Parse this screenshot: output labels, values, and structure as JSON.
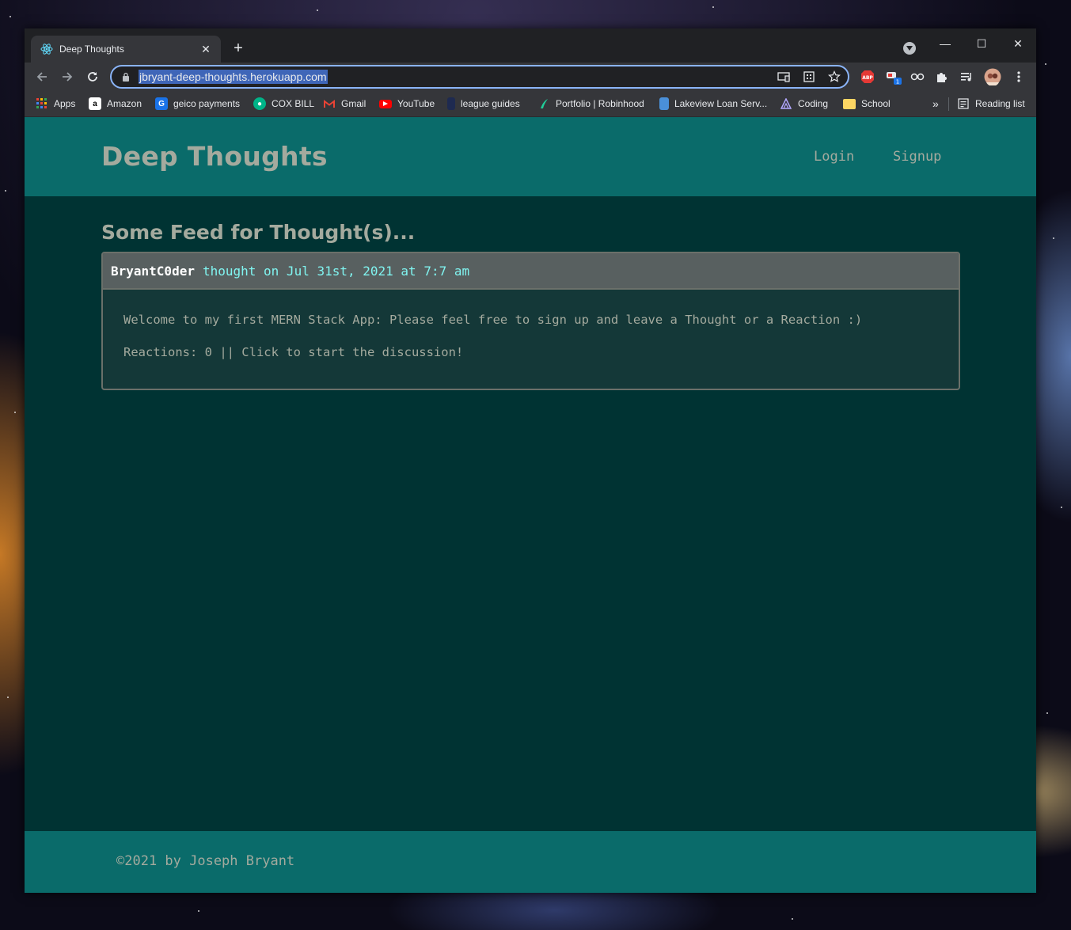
{
  "browser": {
    "tab_title": "Deep Thoughts",
    "url": "jbryant-deep-thoughts.herokuapp.com",
    "icons": {
      "tab_favicon": "react-atom-icon",
      "new_tab": "plus-icon",
      "close": "close-icon",
      "back": "back-arrow-icon",
      "forward": "forward-arrow-icon",
      "reload": "reload-icon",
      "lock": "lock-icon",
      "cast": "cast-icon",
      "qr": "qr-code-icon",
      "star": "bookmark-star-icon",
      "extensions": "puzzle-icon",
      "media": "media-control-icon",
      "menu": "kebab-menu-icon"
    },
    "extensions": [
      "ABP",
      "1"
    ],
    "bookmarks": [
      {
        "label": "Apps",
        "icon": "apps-grid-icon",
        "color": "#ea4335"
      },
      {
        "label": "Amazon",
        "icon": "amazon-icon",
        "color": "#ffffff"
      },
      {
        "label": "geico payments",
        "icon": "geico-icon",
        "color": "#1a73e8"
      },
      {
        "label": "COX BILL",
        "icon": "cox-icon",
        "color": "#00b388"
      },
      {
        "label": "Gmail",
        "icon": "gmail-icon",
        "color": "#ea4335"
      },
      {
        "label": "YouTube",
        "icon": "youtube-icon",
        "color": "#ff0000"
      },
      {
        "label": "league guides",
        "icon": "league-icon",
        "color": "#1e2a50"
      },
      {
        "label": "Portfolio | Robinhood",
        "icon": "robinhood-icon",
        "color": "#21ce99"
      },
      {
        "label": "Lakeview Loan Serv...",
        "icon": "lakeview-icon",
        "color": "#4a90d9"
      },
      {
        "label": "Coding",
        "icon": "coding-icon",
        "color": "#6b5ce7"
      },
      {
        "label": "School",
        "icon": "folder-icon",
        "color": "#fdd663"
      }
    ],
    "overflow_label": "»",
    "reading_list": "Reading list"
  },
  "site": {
    "title": "Deep Thoughts",
    "nav": {
      "login": "Login",
      "signup": "Signup"
    },
    "feed_heading": "Some Feed for Thought(s)...",
    "thought": {
      "username": "BryantC0der",
      "meta": "thought on Jul 31st, 2021 at 7:7 am",
      "text": "Welcome to my first MERN Stack App: Please feel free to sign up and leave a Thought or a Reaction :)",
      "reactions": "Reactions: 0 || Click to start the discussion!"
    },
    "footer": "©2021 by Joseph Bryant"
  },
  "colors": {
    "header_bg": "#0a6b6a",
    "page_bg": "#003333",
    "text": "#a4aa9e",
    "accent": "#80f4f0"
  }
}
